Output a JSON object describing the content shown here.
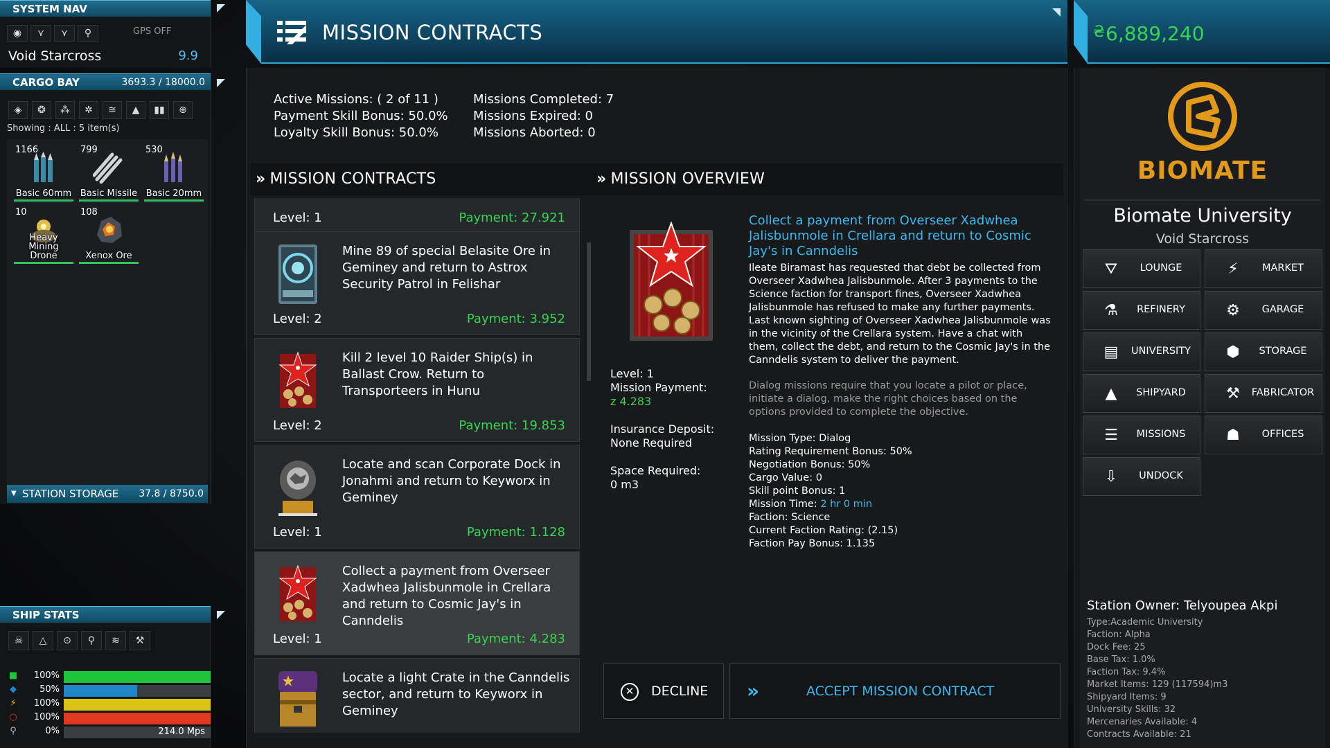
{
  "system_nav": {
    "title": "SYSTEM NAV",
    "gps": "GPS OFF",
    "system_name": "Void Starcross",
    "security": "9.9"
  },
  "cargo_bay": {
    "title": "CARGO BAY",
    "capacity": "3693.3 / 18000.0",
    "showing": "Showing : ALL : 5 item(s)",
    "items": [
      {
        "qty": "1166",
        "label": "Basic 60mm",
        "icon": "bullet-ammo-icon"
      },
      {
        "qty": "799",
        "label": "Basic Missile",
        "icon": "missile-icon"
      },
      {
        "qty": "530",
        "label": "Basic 20mm",
        "icon": "bullet-ammo-icon"
      },
      {
        "qty": "10",
        "label": "Heavy Mining Drone",
        "icon": "drone-icon"
      },
      {
        "qty": "108",
        "label": "Xenox Ore",
        "icon": "ore-icon"
      }
    ],
    "station_storage": "STATION STORAGE",
    "station_storage_capacity": "37.8 / 8750.0"
  },
  "ship_stats": {
    "title": "SHIP STATS",
    "rows": [
      {
        "pct": "100%",
        "value": 1.0,
        "color": "#1ec53a",
        "text": ""
      },
      {
        "pct": "50%",
        "value": 0.5,
        "color": "#1f86c9",
        "text": ""
      },
      {
        "pct": "100%",
        "value": 1.0,
        "color": "#d9c414",
        "text": ""
      },
      {
        "pct": "100%",
        "value": 1.0,
        "color": "#e0391f",
        "text": ""
      },
      {
        "pct": "0%",
        "value": 0.0,
        "color": "#3a3d40",
        "text": "214.0 Mps"
      }
    ]
  },
  "header": {
    "title": "MISSION CONTRACTS",
    "credits": "6,889,240"
  },
  "summary": {
    "active": "Active Missions: ( 2 of 11 )",
    "payment_bonus": "Payment Skill Bonus: 50.0%",
    "loyalty_bonus": "Loyalty Skill Bonus: 50.0%",
    "completed": "Missions Completed: 7",
    "expired": "Missions Expired: 0",
    "aborted": "Missions Aborted: 0"
  },
  "contracts": {
    "title": "MISSION CONTRACTS",
    "partial": {
      "level": "Level: 1",
      "payment": "Payment: 27.921"
    },
    "items": [
      {
        "text": "Mine 89 of special Belasite Ore in Geminey and return to Astrox Security Patrol in Felishar",
        "level": "Level: 2",
        "payment": "Payment: 3.952",
        "icon": "security-badge-icon"
      },
      {
        "text": "Kill 2 level 10 Raider Ship(s) in Ballast Crow. Return to Transporteers in Hunu",
        "level": "Level: 2",
        "payment": "Payment: 19.853",
        "icon": "star-banner-icon"
      },
      {
        "text": "Locate and scan Corporate Dock in Jonahmi and return to Keyworx in Geminey",
        "level": "Level: 1",
        "payment": "Payment: 1.128",
        "icon": "corporate-badge-icon"
      },
      {
        "text": "Collect a payment from Overseer Xadwhea Jalisbunmole in Crellara and return to Cosmic Jay's in Canndelis",
        "level": "Level: 1",
        "payment": "Payment: 4.283",
        "icon": "star-banner-icon"
      },
      {
        "text": "Locate a light Crate in the Canndelis sector, and return to Keyworx in Geminey",
        "level": "",
        "payment": "",
        "icon": "crate-icon"
      }
    ]
  },
  "overview": {
    "title": "MISSION OVERVIEW",
    "mission_title": "Collect a payment from Overseer Xadwhea Jalisbunmole in Crellara and return to Cosmic Jay's in Canndelis",
    "description": "Ileate Biramast has requested that debt be collected from Overseer Xadwhea Jalisbunmole. After 3 payments to the Science faction for transport fines, Overseer Xadwhea Jalisbunmole has refused to make any further payments. Last known sighting of Overseer Xadwhea Jalisbunmole was in the vicinity of the Crellara system. Have a chat with them, collect the debt, and return to the Cosmic Jay's in the Canndelis system to deliver the payment.",
    "note": "Dialog missions require that you locate a pilot or place, initiate a dialog, make the right choices based on the options provided to complete the objective.",
    "level": "Level: 1",
    "payment_label": "Mission Payment:",
    "payment_value": "z 4.283",
    "insurance_label": "Insurance Deposit:",
    "insurance_value": "None Required",
    "space_label": "Space Required:",
    "space_value": "0 m3",
    "details": [
      "Mission Type: Dialog",
      "Rating Requirement Bonus: 50%",
      "Negotiation Bonus: 50%",
      "Cargo Value: 0",
      "Skill point Bonus: 1"
    ],
    "time_label": "Mission Time: ",
    "time_value": "2 hr 0 min",
    "details2": [
      "Faction: Science",
      "Current Faction Rating: (2.15)",
      "Faction Pay Bonus: 1.135"
    ],
    "decline": "DECLINE",
    "accept": "ACCEPT MISSION CONTRACT"
  },
  "station": {
    "logo": "BIOMATE",
    "name": "Biomate University",
    "system": "Void Starcross",
    "services": [
      {
        "label": "LOUNGE",
        "icon": "lounge-icon",
        "glyph": "⛛"
      },
      {
        "label": "MARKET",
        "icon": "market-icon",
        "glyph": "⚡"
      },
      {
        "label": "REFINERY",
        "icon": "refinery-icon",
        "glyph": "⚗"
      },
      {
        "label": "GARAGE",
        "icon": "garage-icon",
        "glyph": "⚙"
      },
      {
        "label": "UNIVERSITY",
        "icon": "university-icon",
        "glyph": "▤"
      },
      {
        "label": "STORAGE",
        "icon": "storage-icon",
        "glyph": "⬢"
      },
      {
        "label": "SHIPYARD",
        "icon": "shipyard-icon",
        "glyph": "▲"
      },
      {
        "label": "FABRICATOR",
        "icon": "fabricator-icon",
        "glyph": "⚒"
      },
      {
        "label": "MISSIONS",
        "icon": "missions-icon",
        "glyph": "☰"
      },
      {
        "label": "OFFICES",
        "icon": "offices-icon",
        "glyph": "☗"
      },
      {
        "label": "UNDOCK",
        "icon": "undock-icon",
        "glyph": "⇩"
      }
    ],
    "owner": "Station Owner: Telyoupea Akpi",
    "info": [
      "Type:Academic University",
      "Faction: Alpha",
      "Dock Fee: 25",
      "Base Tax: 1.0%",
      "Faction Tax: 9.4%",
      "Market Items: 129 (117594)m3",
      "Shipyard Items: 9",
      "University Skills: 32",
      "Mercenaries Available: 4",
      "Contracts Available: 21"
    ]
  }
}
